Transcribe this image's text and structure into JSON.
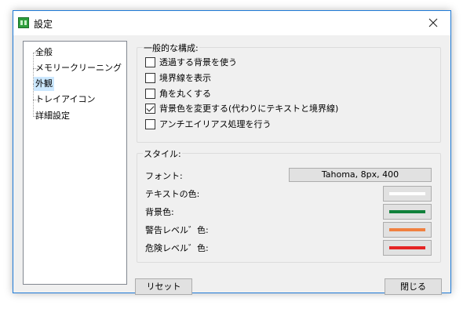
{
  "window": {
    "title": "設定"
  },
  "tree": {
    "items": [
      {
        "label": "全般",
        "selected": false
      },
      {
        "label": "メモリークリーニング",
        "selected": false
      },
      {
        "label": "外観",
        "selected": true
      },
      {
        "label": "トレイアイコン",
        "selected": false
      },
      {
        "label": "詳細設定",
        "selected": false
      }
    ]
  },
  "general": {
    "heading": "一般的な構成:",
    "options": [
      {
        "label": "透過する背景を使う",
        "checked": false
      },
      {
        "label": "境界線を表示",
        "checked": false
      },
      {
        "label": "角を丸くする",
        "checked": false
      },
      {
        "label": "背景色を変更する(代わりにテキストと境界線)",
        "checked": true
      },
      {
        "label": "アンチエイリアス処理を行う",
        "checked": false
      }
    ]
  },
  "style": {
    "heading": "スタイル:",
    "font_label": "フォント:",
    "font_value": "Tahoma, 8px, 400",
    "colors": [
      {
        "label": "テキストの色:",
        "color": "#ffffff"
      },
      {
        "label": "背景色:",
        "color": "#11813b"
      },
      {
        "label": "警告レベル゛色:",
        "color": "#f08040"
      },
      {
        "label": "危険レベル゛色:",
        "color": "#e52424"
      }
    ]
  },
  "buttons": {
    "reset": "リセット",
    "close": "閉じる"
  }
}
